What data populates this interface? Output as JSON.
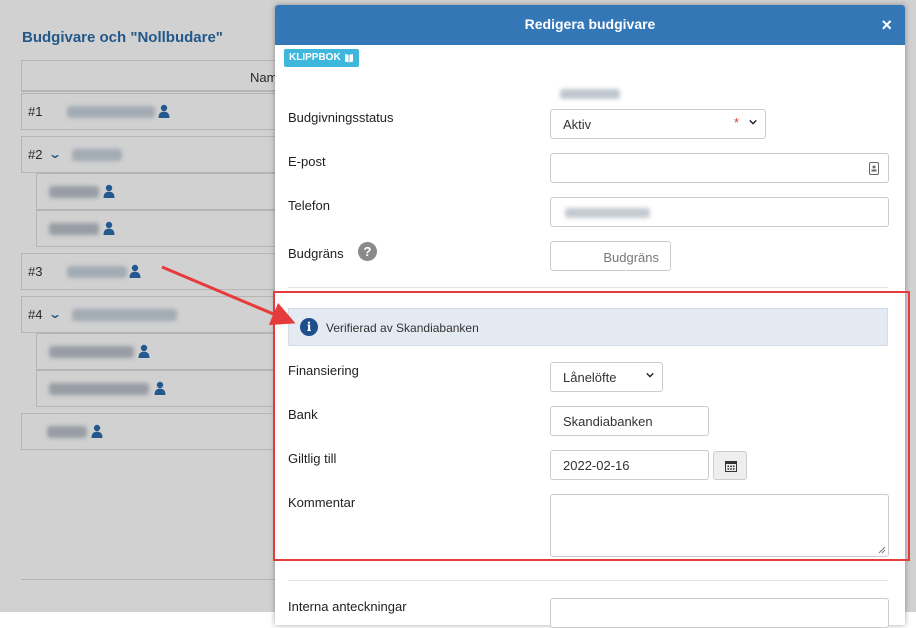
{
  "background": {
    "title": "Budgivare och \"Nollbudare\"",
    "table_header": "Namn",
    "rows": [
      {
        "num": "#1"
      },
      {
        "num": "#2"
      },
      {
        "num": "#3"
      },
      {
        "num": "#4"
      }
    ]
  },
  "modal": {
    "title": "Redigera budgivare",
    "close_symbol": "×",
    "clipboard_label": "KLIPPBOK",
    "fields": {
      "status_label": "Budgivningsstatus",
      "status_value": "Aktiv",
      "status_required": "*",
      "email_label": "E-post",
      "email_value": "",
      "phone_label": "Telefon",
      "bid_limit_label": "Budgräns",
      "bid_limit_placeholder": "Budgräns",
      "help_symbol": "?"
    },
    "verification": {
      "info_symbol": "i",
      "text": "Verifierad av Skandiabanken",
      "financing_label": "Finansiering",
      "financing_value": "Lånelöfte",
      "bank_label": "Bank",
      "bank_value": "Skandiabanken",
      "valid_until_label": "Giltlig till",
      "valid_until_value": "2022-02-16",
      "comment_label": "Kommentar",
      "comment_value": ""
    },
    "internal_notes_label": "Interna anteckningar"
  },
  "colors": {
    "header_blue": "#3477b7",
    "link_blue": "#2b6ca8",
    "badge_cyan": "#3fb6dc",
    "highlight_red": "#e53b3b",
    "info_bg": "#e4eaf2"
  },
  "icons": {
    "close": "close-icon",
    "clipboard": "book-icon",
    "caret": "chevron-down-icon",
    "help": "question-icon",
    "info": "info-icon",
    "calendar": "calendar-icon",
    "contact": "contact-card-icon",
    "person": "person-icon"
  }
}
